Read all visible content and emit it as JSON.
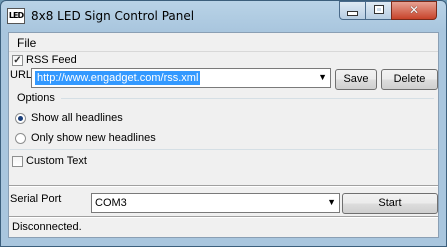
{
  "window": {
    "title": "8x8 LED Sign Control Panel",
    "icon_text": "LED"
  },
  "menu": {
    "file_label": "File"
  },
  "rss": {
    "checkbox_label": "RSS Feed",
    "checked": true,
    "url_label": "URL",
    "url_value": "http://www.engadget.com/rss.xml",
    "save_label": "Save",
    "delete_label": "Delete"
  },
  "options": {
    "group_label": "Options",
    "show_all_label": "Show all headlines",
    "show_new_label": "Only show new headlines",
    "selected": "show_all"
  },
  "custom_text": {
    "checkbox_label": "Custom Text",
    "checked": false
  },
  "serial": {
    "label": "Serial Port",
    "port_value": "COM3",
    "start_label": "Start"
  },
  "status": {
    "text": "Disconnected."
  }
}
